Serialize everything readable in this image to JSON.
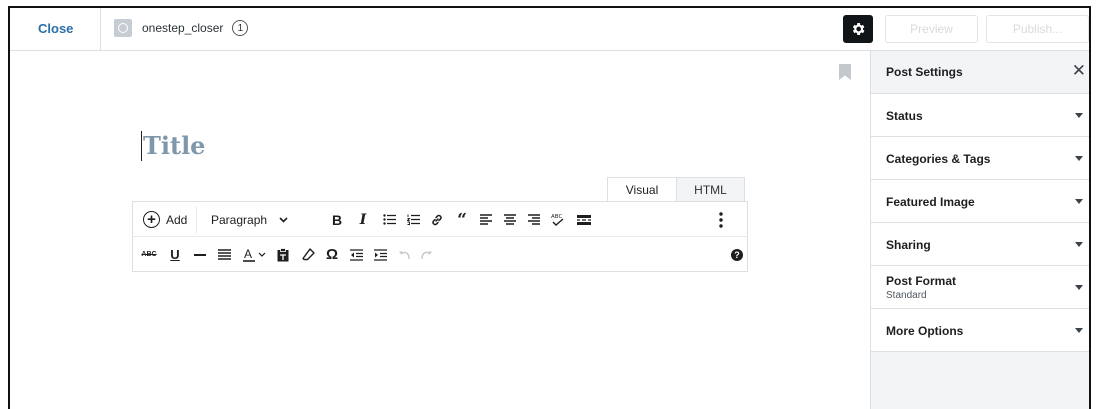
{
  "topbar": {
    "close_label": "Close",
    "site_name": "onestep_closer",
    "site_badge": "1",
    "preview_label": "Preview",
    "publish_label": "Publish..."
  },
  "editor": {
    "title_placeholder": "Title",
    "tabs": {
      "visual": "Visual",
      "html": "HTML"
    },
    "toolbar": {
      "add_label": "Add",
      "format_select": "Paragraph",
      "row1_icons": [
        "bold-icon",
        "italic-icon",
        "bulleted-list-icon",
        "numbered-list-icon",
        "link-icon",
        "blockquote-icon",
        "align-left-icon",
        "align-center-icon",
        "align-right-icon",
        "spellcheck-icon",
        "more-tag-icon",
        "more-vertical-icon"
      ],
      "row2_icons": [
        "strikethrough-icon",
        "underline-icon",
        "horizontal-line-icon",
        "justify-icon",
        "text-color-icon",
        "paste-text-icon",
        "clear-formatting-icon",
        "special-character-icon",
        "outdent-icon",
        "indent-icon",
        "undo-icon",
        "redo-icon",
        "help-icon"
      ]
    }
  },
  "sidebar": {
    "header": "Post Settings",
    "sections": [
      {
        "label": "Status"
      },
      {
        "label": "Categories & Tags"
      },
      {
        "label": "Featured Image"
      },
      {
        "label": "Sharing"
      },
      {
        "label": "Post Format",
        "sublabel": "Standard"
      },
      {
        "label": "More Options"
      }
    ]
  },
  "colors": {
    "link": "#2a6fa8",
    "title_placeholder": "#7f97ab",
    "panel_bg": "#f2f4f6"
  }
}
